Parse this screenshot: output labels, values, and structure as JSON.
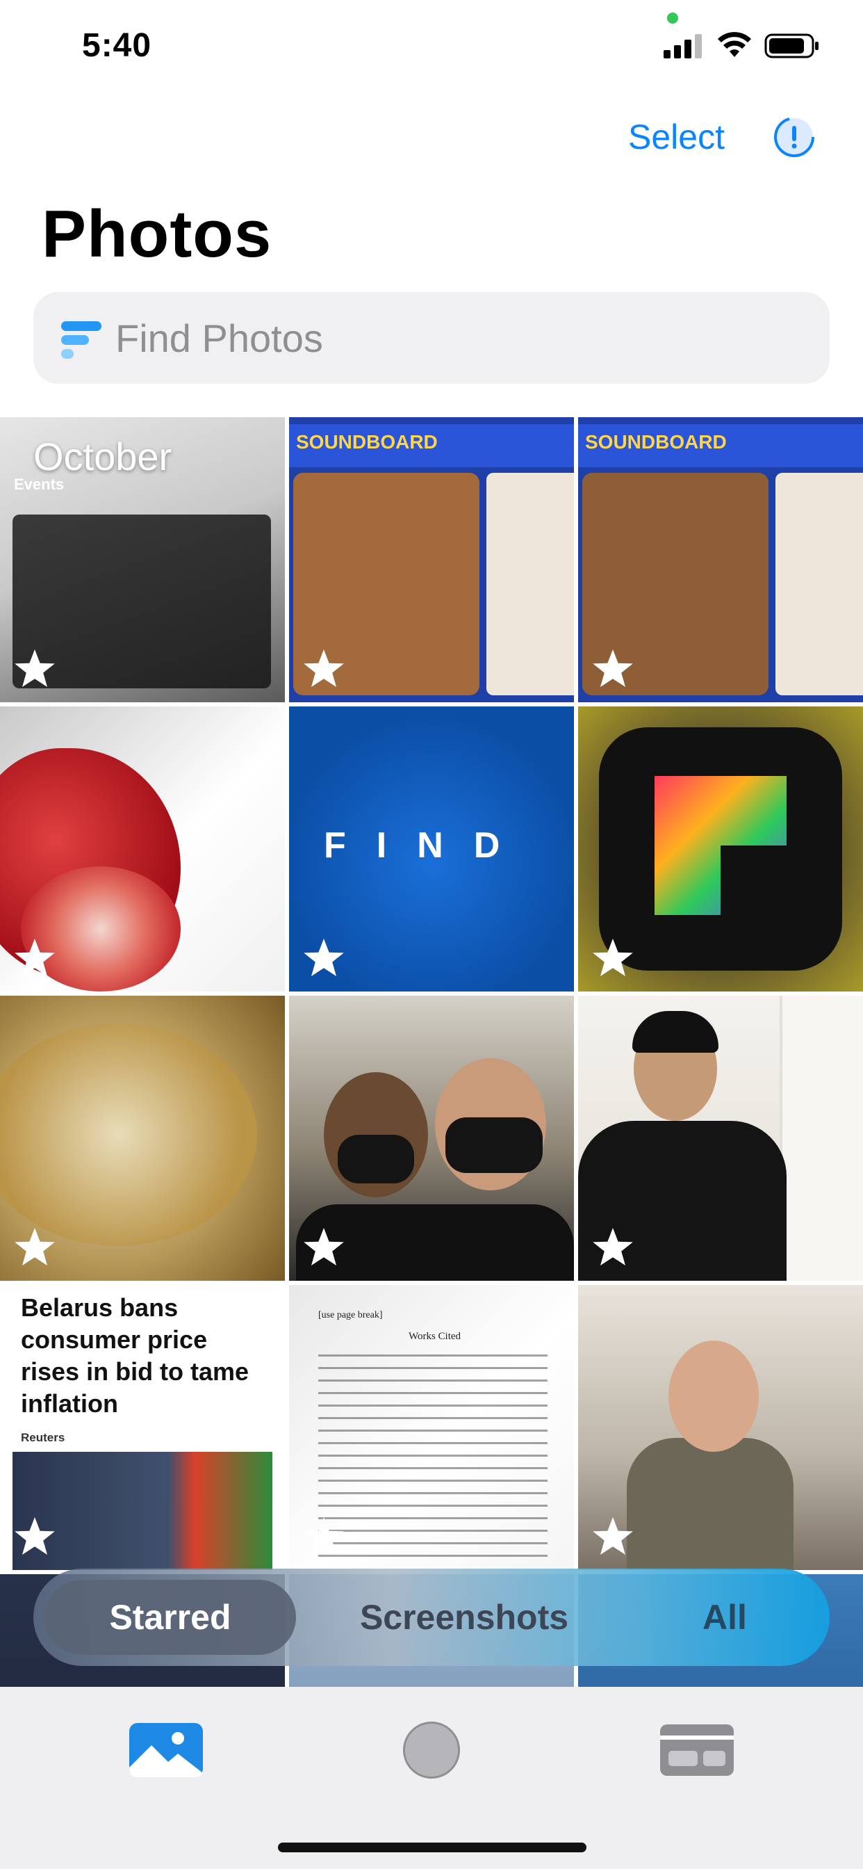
{
  "status_bar": {
    "time": "5:40"
  },
  "header": {
    "select_label": "Select",
    "title": "Photos"
  },
  "search": {
    "placeholder": "Find Photos"
  },
  "grid": {
    "first_label": "October",
    "cells": [
      {
        "name": "events-screenshot",
        "starred": true
      },
      {
        "name": "soundboard-screenshot-1",
        "starred": true
      },
      {
        "name": "soundboard-screenshot-2",
        "starred": true
      },
      {
        "name": "strawberry-photo",
        "starred": true
      },
      {
        "name": "find-app-image",
        "starred": true
      },
      {
        "name": "app-icon-image",
        "starred": true
      },
      {
        "name": "food-photo",
        "starred": true
      },
      {
        "name": "selfie-photo",
        "starred": true
      },
      {
        "name": "suit-photo",
        "starred": true
      },
      {
        "name": "news-screenshot",
        "starred": true
      },
      {
        "name": "document-screenshot",
        "starred": true
      },
      {
        "name": "room-photo",
        "starred": true
      }
    ],
    "news_headline": "Belarus bans consumer price rises in bid to tame inflation",
    "news_source": "Reuters",
    "doc_line1": "[use page break]",
    "doc_title": "Works Cited",
    "events_title": "Events",
    "soundboard_title": "SOUNDBOARD",
    "find_word": "FIND"
  },
  "segments": {
    "items": [
      {
        "label": "Starred",
        "active": true
      },
      {
        "label": "Screenshots",
        "active": false
      },
      {
        "label": "All",
        "active": false
      }
    ]
  },
  "tabbar": {
    "items": [
      {
        "icon": "photos-icon",
        "active": true
      },
      {
        "icon": "camera-icon",
        "active": false
      },
      {
        "icon": "cards-icon",
        "active": false
      }
    ]
  },
  "colors": {
    "accent": "#0a84ff",
    "segment_active": "#5a6476"
  }
}
